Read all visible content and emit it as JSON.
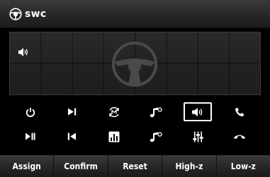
{
  "header": {
    "title": "swc",
    "logo_icon": "steering-wheel-icon"
  },
  "panel": {
    "volume_icon": "volume-icon",
    "center_icon": "steering-wheel-icon"
  },
  "buttons": [
    {
      "name": "power-button",
      "icon": "power-icon"
    },
    {
      "name": "next-track-button",
      "icon": "next-track-icon"
    },
    {
      "name": "mode-button",
      "icon": "mode-icon"
    },
    {
      "name": "music-up-button",
      "icon": "music-note-icon"
    },
    {
      "name": "volume-button",
      "icon": "volume-icon",
      "selected": true
    },
    {
      "name": "call-button",
      "icon": "phone-icon"
    },
    {
      "name": "play-pause-button",
      "icon": "play-pause-icon"
    },
    {
      "name": "previous-track-button",
      "icon": "previous-track-icon"
    },
    {
      "name": "equalizer-button",
      "icon": "equalizer-icon"
    },
    {
      "name": "music-down-button",
      "icon": "music-note-icon"
    },
    {
      "name": "eq-settings-button",
      "icon": "equalizer-sliders-icon"
    },
    {
      "name": "hang-up-button",
      "icon": "hang-up-icon"
    }
  ],
  "bottom_bar": {
    "assign": "Assign",
    "confirm": "Confirm",
    "reset": "Reset",
    "high_z": "High-z",
    "low_z": "Low-z"
  },
  "colors": {
    "background": "#000000",
    "accent": "#ffffff",
    "panel": "#252525"
  }
}
